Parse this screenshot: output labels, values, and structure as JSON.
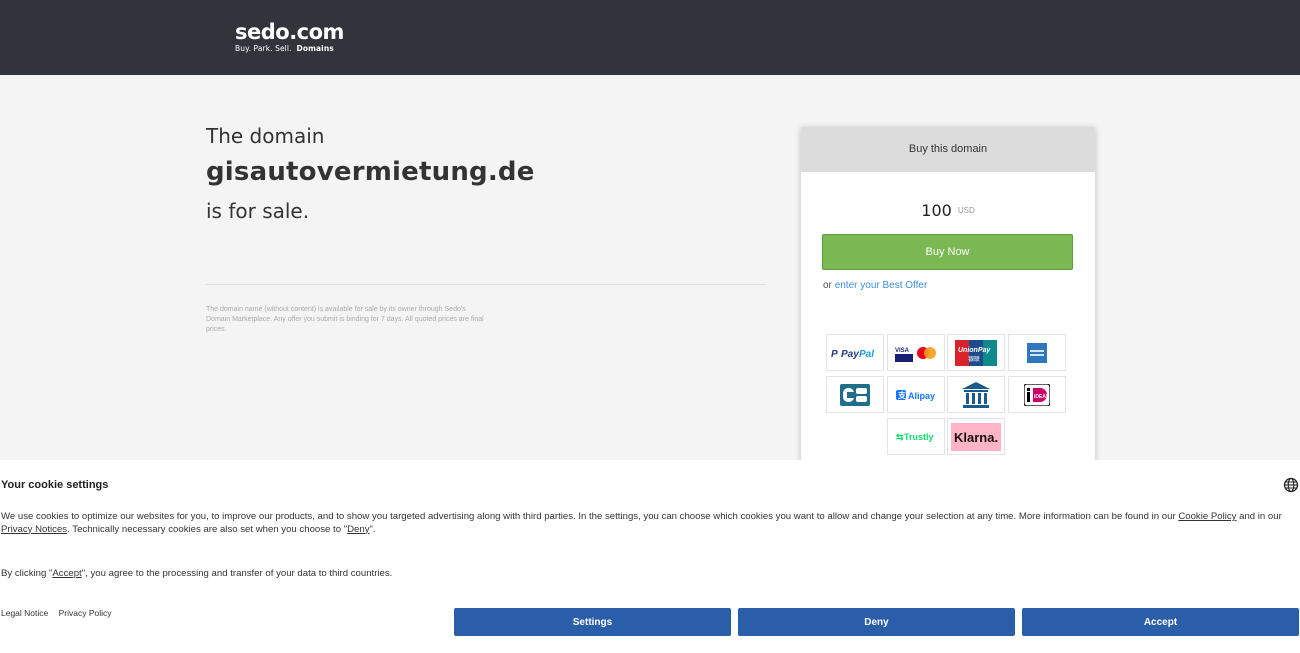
{
  "header": {
    "logo_main": "sedo.com",
    "logo_tagline": "Buy.  Park.  Sell.",
    "logo_tagline_bold": "Domains"
  },
  "main": {
    "intro": "The domain",
    "domain": "gisautovermietung.de",
    "suffix": "is for sale.",
    "disclaimer": "The domain name (without content) is available for sale by its owner through Sedo's Domain Marketplace. Any offer you submit is binding for 7 days. All quoted prices are final prices."
  },
  "buy_card": {
    "title": "Buy this domain",
    "price": "100",
    "currency": "USD",
    "buy_label": "Buy Now",
    "offer_prefix": "or",
    "offer_link": "enter your Best Offer",
    "payment_methods": [
      {
        "name": "PayPal",
        "icon": "paypal-logo"
      },
      {
        "name": "Visa / Mastercard",
        "icon": "visa-mastercard-logo"
      },
      {
        "name": "UnionPay",
        "icon": "unionpay-logo"
      },
      {
        "name": "American Express",
        "icon": "amex-logo"
      },
      {
        "name": "CB",
        "icon": "cb-logo"
      },
      {
        "name": "Alipay",
        "icon": "alipay-logo"
      },
      {
        "name": "Bank transfer",
        "icon": "bank-icon"
      },
      {
        "name": "iDEAL",
        "icon": "ideal-logo"
      },
      {
        "name": "Trustly",
        "icon": "trustly-logo"
      },
      {
        "name": "Klarna.",
        "icon": "klarna-logo"
      }
    ],
    "colors": {
      "buy_button": "#7ab851",
      "link": "#3b8fd6"
    }
  },
  "cookie": {
    "title": "Your cookie settings",
    "text_1": "We use cookies to optimize our websites for you, to improve our products, and to show you targeted advertising along with third parties. In the settings, you can choose which cookies you want to allow and change your selection at any time. More information can be found in our",
    "link_cookie_policy": "Cookie Policy",
    "text_2": "and in our",
    "link_privacy_notices": "Privacy Notices",
    "text_3": ". Technically necessary cookies are also set when you choose to \"",
    "link_deny": "Deny",
    "text_4": "\".",
    "accept_text_1": "By clicking \"",
    "link_accept": "Accept",
    "accept_text_2": "\", you agree to the processing and transfer of your data to third countries.",
    "legal_notice": "Legal Notice",
    "privacy_policy": "Privacy Policy",
    "btn_settings": "Settings",
    "btn_deny": "Deny",
    "btn_accept": "Accept",
    "button_color": "#2a5ea8"
  }
}
